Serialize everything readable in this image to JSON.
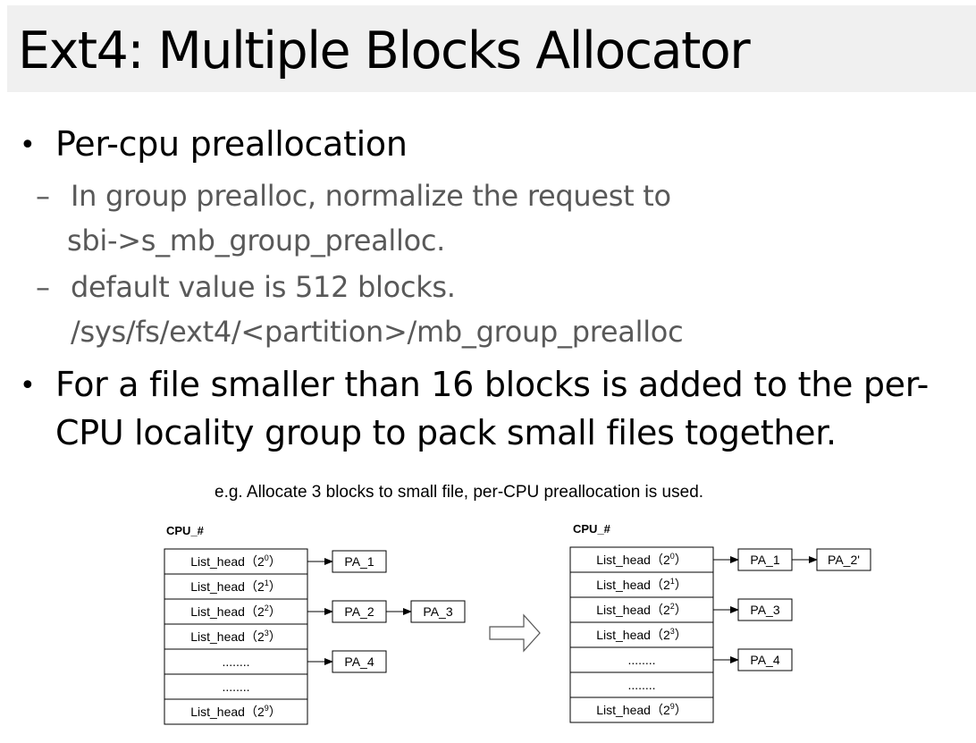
{
  "title": "Ext4: Multiple Blocks Allocator",
  "bullets": [
    {
      "text": "Per-cpu preallocation",
      "subs": [
        {
          "line1": "In group prealloc,  normalize the request to",
          "line2": "sbi->s_mb_group_prealloc."
        },
        {
          "line1": "default value is 512 blocks.",
          "line2": "/sys/fs/ext4/<partition>/mb_group_prealloc"
        }
      ]
    },
    {
      "line1": "For a file smaller than 16 blocks is added to the per-",
      "line2": "CPU locality group to pack small files together."
    }
  ],
  "diagram": {
    "caption": "e.g. Allocate 3 blocks to small file, per-CPU preallocation is used.",
    "before": {
      "label": "CPU_#",
      "rows": [
        {
          "text": "List_head（2",
          "sup": "0",
          "tail": "）",
          "pa": [
            "PA_1"
          ]
        },
        {
          "text": "List_head（2",
          "sup": "1",
          "tail": "）",
          "pa": []
        },
        {
          "text": "List_head（2",
          "sup": "2",
          "tail": "）",
          "pa": [
            "PA_2",
            "PA_3"
          ]
        },
        {
          "text": "List_head（2",
          "sup": "3",
          "tail": "）",
          "pa": []
        },
        {
          "text": "........",
          "sup": "",
          "tail": "",
          "pa": [
            "PA_4"
          ]
        },
        {
          "text": "........",
          "sup": "",
          "tail": "",
          "pa": []
        },
        {
          "text": "List_head（2",
          "sup": "9",
          "tail": "）",
          "pa": []
        }
      ]
    },
    "after": {
      "label": "CPU_#",
      "rows": [
        {
          "text": "List_head（2",
          "sup": "0",
          "tail": "）",
          "pa": [
            "PA_1",
            "PA_2'"
          ]
        },
        {
          "text": "List_head（2",
          "sup": "1",
          "tail": "）",
          "pa": []
        },
        {
          "text": "List_head（2",
          "sup": "2",
          "tail": "）",
          "pa": [
            "PA_3"
          ]
        },
        {
          "text": "List_head（2",
          "sup": "3",
          "tail": "）",
          "pa": []
        },
        {
          "text": "........",
          "sup": "",
          "tail": "",
          "pa": [
            "PA_4"
          ]
        },
        {
          "text": "........",
          "sup": "",
          "tail": "",
          "pa": []
        },
        {
          "text": "List_head（2",
          "sup": "9",
          "tail": "）",
          "pa": []
        }
      ]
    }
  }
}
